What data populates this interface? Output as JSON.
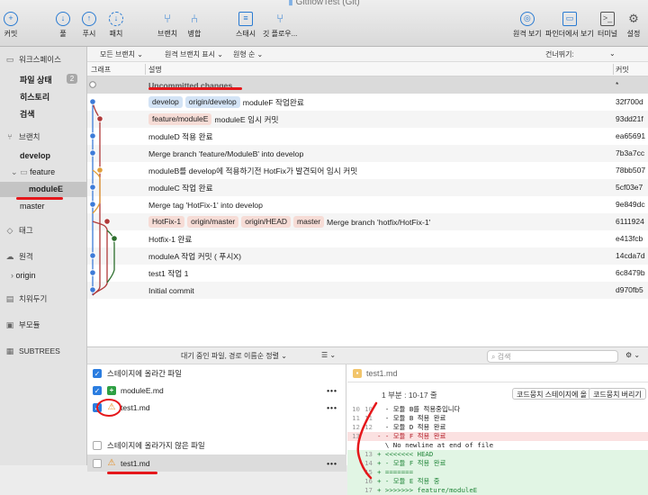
{
  "window": {
    "title": "GitflowTest (Git)"
  },
  "toolbar": {
    "commit": "커밋",
    "pull": "풀",
    "push": "푸시",
    "fetch": "패치",
    "branch": "브랜치",
    "merge": "병합",
    "stash": "스태시",
    "gitflow": "깃 플로우...",
    "remote": "원격 보기",
    "finder": "파인더에서 보기",
    "terminal": "터미널",
    "settings": "설정"
  },
  "sidebar": {
    "workspace": "워크스페이스",
    "file_status": "파일 상태",
    "file_status_count": "2",
    "history": "히스토리",
    "search": "검색",
    "branches": "브랜치",
    "develop": "develop",
    "feature": "feature",
    "moduleE": "moduleE",
    "master": "master",
    "tags": "태그",
    "remotes": "원격",
    "origin": "origin",
    "stashes": "치워두기",
    "submodules": "부모듈",
    "subtrees": "SUBTREES"
  },
  "filter": {
    "branches": "모든 브랜치",
    "remote": "원격 브랜치 표시",
    "order": "원형 순",
    "skip": "건너뛰기:"
  },
  "columns": {
    "graph": "그래프",
    "description": "설명",
    "commit": "커밋"
  },
  "commits": [
    {
      "message": "Uncommitted changes",
      "hash": "*",
      "tags": []
    },
    {
      "message": "moduleF 작업완료",
      "hash": "32f700d",
      "tags": [
        {
          "label": "develop",
          "color": "blue"
        },
        {
          "label": "origin/develop",
          "color": "blue"
        }
      ]
    },
    {
      "message": "moduleE 임시 커밋",
      "hash": "93dd21f",
      "tags": [
        {
          "label": "feature/moduleE",
          "color": "red"
        }
      ]
    },
    {
      "message": "moduleD 적용 완료",
      "hash": "ea65691",
      "tags": []
    },
    {
      "message": "Merge branch 'feature/ModuleB' into develop",
      "hash": "7b3a7cc",
      "tags": []
    },
    {
      "message": "moduleB를 develop에 적용하기전 HotFix가 발견되어 임시 커밋",
      "hash": "78bb507",
      "tags": []
    },
    {
      "message": "moduleC 작업 완료",
      "hash": "5cf03e7",
      "tags": []
    },
    {
      "message": "Merge tag 'HotFix-1' into develop",
      "hash": "9e849dc",
      "tags": []
    },
    {
      "message": "Merge branch 'hotfix/HotFix-1'",
      "hash": "6111924",
      "tags": [
        {
          "label": "HotFix-1",
          "color": "red"
        },
        {
          "label": "origin/master",
          "color": "red"
        },
        {
          "label": "origin/HEAD",
          "color": "red"
        },
        {
          "label": "master",
          "color": "red"
        }
      ]
    },
    {
      "message": "Hotfix-1 완료",
      "hash": "e413fcb",
      "tags": []
    },
    {
      "message": "moduleA 작업 커밋 ( 푸시X)",
      "hash": "14cda7d",
      "tags": []
    },
    {
      "message": "test1 작업 1",
      "hash": "6c8479b",
      "tags": []
    },
    {
      "message": "Initial commit",
      "hash": "d970fb5",
      "tags": []
    }
  ],
  "staging": {
    "filter": "대기 중인 파일, 경로 이름순 정렬",
    "search_placeholder": "검색",
    "staged_header": "스테이지에 올라간 파일",
    "unstaged_header": "스테이지에 올라가지 않은 파일",
    "staged_files": [
      {
        "name": "moduleE.md",
        "status": "added"
      },
      {
        "name": "test1.md",
        "status": "conflict"
      }
    ],
    "unstaged_files": [
      {
        "name": "test1.md",
        "status": "conflict"
      }
    ]
  },
  "diff": {
    "file": "test1.md",
    "hunk": "1 부분 : 10-17 줄",
    "stage_hunk": "코드뭉치 스테이지에 올",
    "discard_hunk": "코드뭉치 버리기",
    "lines": [
      {
        "o": "10",
        "n": "10",
        "type": "ctx",
        "text": "  - 모듈 B를 적용중입니다"
      },
      {
        "o": "11",
        "n": "11",
        "type": "ctx",
        "text": "  - 모듈 B 적용 완료"
      },
      {
        "o": "12",
        "n": "12",
        "type": "ctx",
        "text": "  - 모듈 D 적용 완료"
      },
      {
        "o": "13",
        "n": "",
        "type": "del",
        "text": "- - 모듈 F 적용 완료"
      },
      {
        "o": "",
        "n": "",
        "type": "ctx",
        "text": "  \\ No newline at end of file"
      },
      {
        "o": "",
        "n": "13",
        "type": "add",
        "text": "+ <<<<<<< HEAD"
      },
      {
        "o": "",
        "n": "14",
        "type": "add",
        "text": "+ - 모듈 F 적용 완료"
      },
      {
        "o": "",
        "n": "15",
        "type": "add",
        "text": "+ ======="
      },
      {
        "o": "",
        "n": "16",
        "type": "add",
        "text": "+ - 모듈 E 적용 중"
      },
      {
        "o": "",
        "n": "17",
        "type": "add",
        "text": "+ >>>>>>> feature/moduleE"
      }
    ]
  }
}
